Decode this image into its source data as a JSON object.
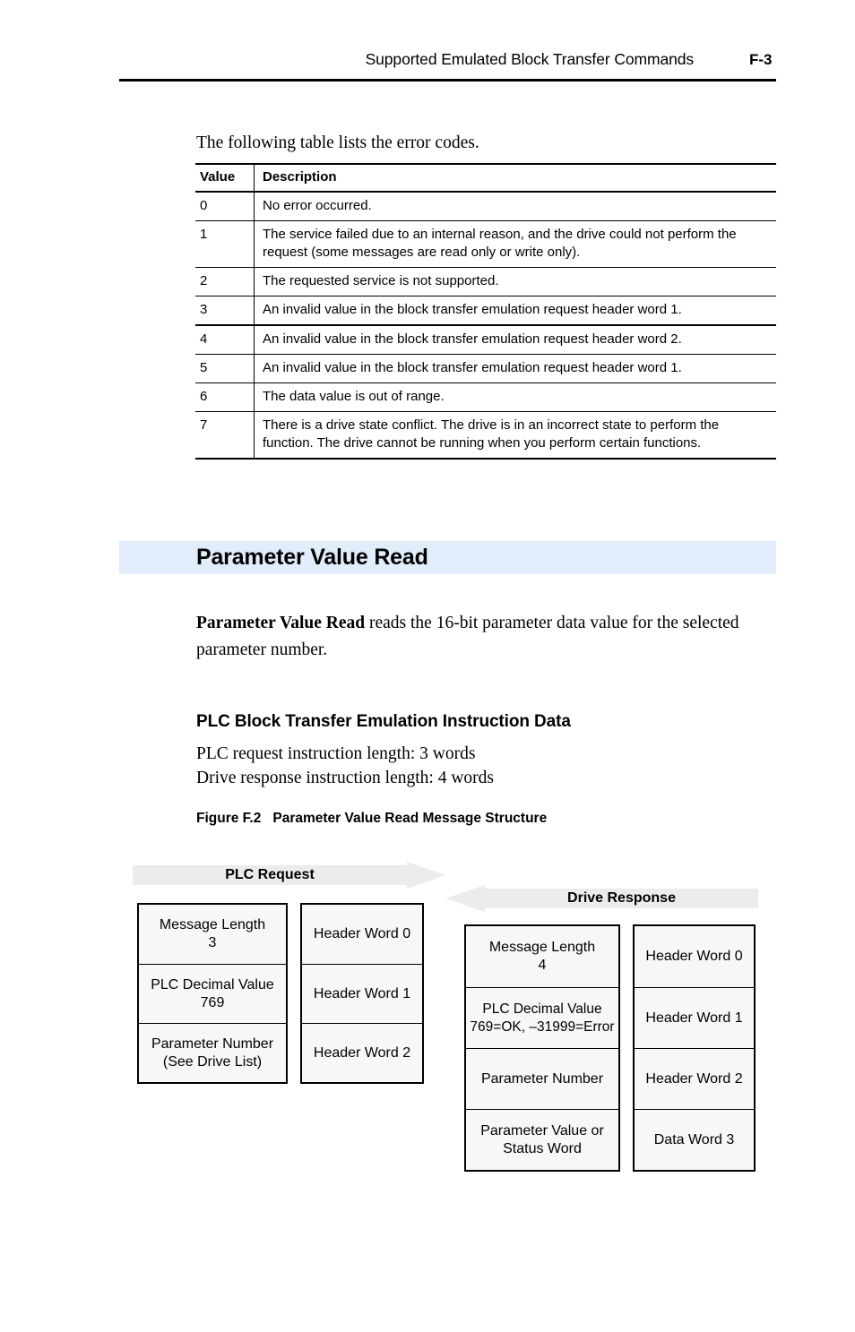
{
  "header": {
    "title": "Supported Emulated Block Transfer Commands",
    "folio": "F-3"
  },
  "intro": {
    "paragraph": "The following table lists the error codes."
  },
  "error_table": {
    "columns": [
      "Value",
      "Description"
    ],
    "rows": [
      {
        "value": "0",
        "description": "No error occurred."
      },
      {
        "value": "1",
        "description": "The service failed due to an internal reason, and the drive could not perform the request (some messages are read only or write only)."
      },
      {
        "value": "2",
        "description": "The requested service is not supported."
      },
      {
        "value": "3",
        "description": "An invalid value in the block transfer emulation request header word 1."
      },
      {
        "value": "4",
        "description": "An invalid value in the block transfer emulation request header word 2."
      },
      {
        "value": "5",
        "description": "An invalid value in the block transfer emulation request header word 1."
      },
      {
        "value": "6",
        "description": "The data value is out of range."
      },
      {
        "value": "7",
        "description": "There is a drive state conflict. The drive is in an incorrect state to perform the function. The drive cannot be running when you perform certain functions."
      }
    ]
  },
  "section": {
    "title": "Parameter Value Read",
    "band_color": "#e1edfb",
    "body_lead": "Parameter Value Read",
    "body_rest": " reads the 16-bit parameter data value for the selected parameter number.",
    "subsection_title": "PLC Block Transfer Emulation Instruction Data",
    "request_length": "PLC request instruction length: 3 words",
    "response_length": "Drive response instruction length: 4 words"
  },
  "figure": {
    "caption_number": "Figure F.2",
    "caption_text": "Parameter Value Read Message Structure",
    "banner_fill": "#ececec",
    "request": {
      "banner_label": "PLC Request",
      "content_cells": [
        {
          "line1": "Message Length",
          "line2": "3"
        },
        {
          "line1": "PLC Decimal Value",
          "line2": "769"
        },
        {
          "line1": "Parameter Number",
          "line2": "(See Drive List)"
        }
      ],
      "word_cells": [
        {
          "line1": "Header Word 0",
          "line2": ""
        },
        {
          "line1": "Header Word 1",
          "line2": ""
        },
        {
          "line1": "Header Word 2",
          "line2": ""
        }
      ]
    },
    "response": {
      "banner_label": "Drive Response",
      "content_cells": [
        {
          "line1": "Message Length",
          "line2": "4"
        },
        {
          "line1": "PLC Decimal Value",
          "line2": "769=OK, –31999=Error"
        },
        {
          "line1": "Parameter Number",
          "line2": ""
        },
        {
          "line1": "Parameter Value or",
          "line2": "Status Word"
        }
      ],
      "word_cells": [
        {
          "line1": "Header Word 0",
          "line2": ""
        },
        {
          "line1": "Header Word 1",
          "line2": ""
        },
        {
          "line1": "Header Word 2",
          "line2": ""
        },
        {
          "line1": "Data Word 3",
          "line2": ""
        }
      ]
    }
  }
}
